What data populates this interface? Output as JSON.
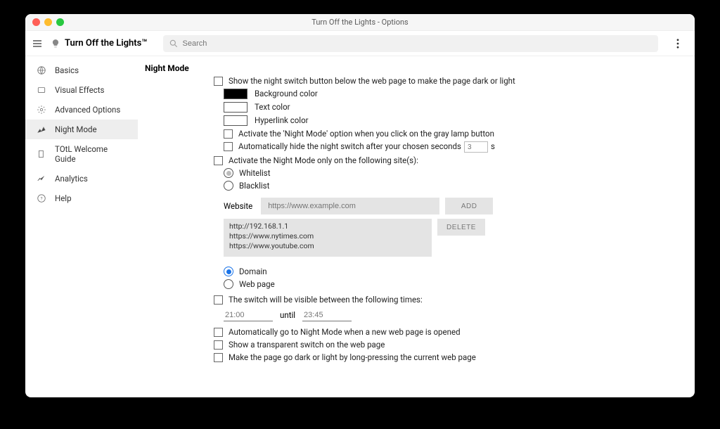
{
  "window_title": "Turn Off the Lights - Options",
  "brand_name": "Turn Off the Lights™",
  "search_placeholder": "Search",
  "sidebar": {
    "items": [
      {
        "label": "Basics"
      },
      {
        "label": "Visual Effects"
      },
      {
        "label": "Advanced Options"
      },
      {
        "label": "Night Mode"
      },
      {
        "label": "TOtL Welcome Guide"
      },
      {
        "label": "Analytics"
      },
      {
        "label": "Help"
      }
    ]
  },
  "section": {
    "title": "Night Mode",
    "show_switch_label": "Show the night switch button below the web page to make the page dark or light",
    "bg_color_label": "Background color",
    "text_color_label": "Text color",
    "hyperlink_color_label": "Hyperlink color",
    "activate_gray_lamp": "Activate the 'Night Mode' option when you click on the gray lamp button",
    "auto_hide_prefix": "Automatically hide the night switch after your chosen seconds",
    "auto_hide_value": "3",
    "auto_hide_suffix": "s",
    "only_sites_label": "Activate the Night Mode only on the following site(s):",
    "whitelist_label": "Whitelist",
    "blacklist_label": "Blacklist",
    "website_label": "Website",
    "website_placeholder": "https://www.example.com",
    "add_btn": "ADD",
    "delete_btn": "DELETE",
    "site_list": "http://192.168.1.1\nhttps://www.nytimes.com\nhttps://www.youtube.com",
    "domain_label": "Domain",
    "webpage_label": "Web page",
    "visible_times_label": "The switch will be visible between the following times:",
    "time_from": "21:00",
    "time_until_label": "until",
    "time_to": "23:45",
    "auto_night_label": "Automatically go to Night Mode when a new web page is opened",
    "transparent_switch_label": "Show a transparent switch on the web page",
    "longpress_label": "Make the page go dark or light by long-pressing the current web page"
  }
}
